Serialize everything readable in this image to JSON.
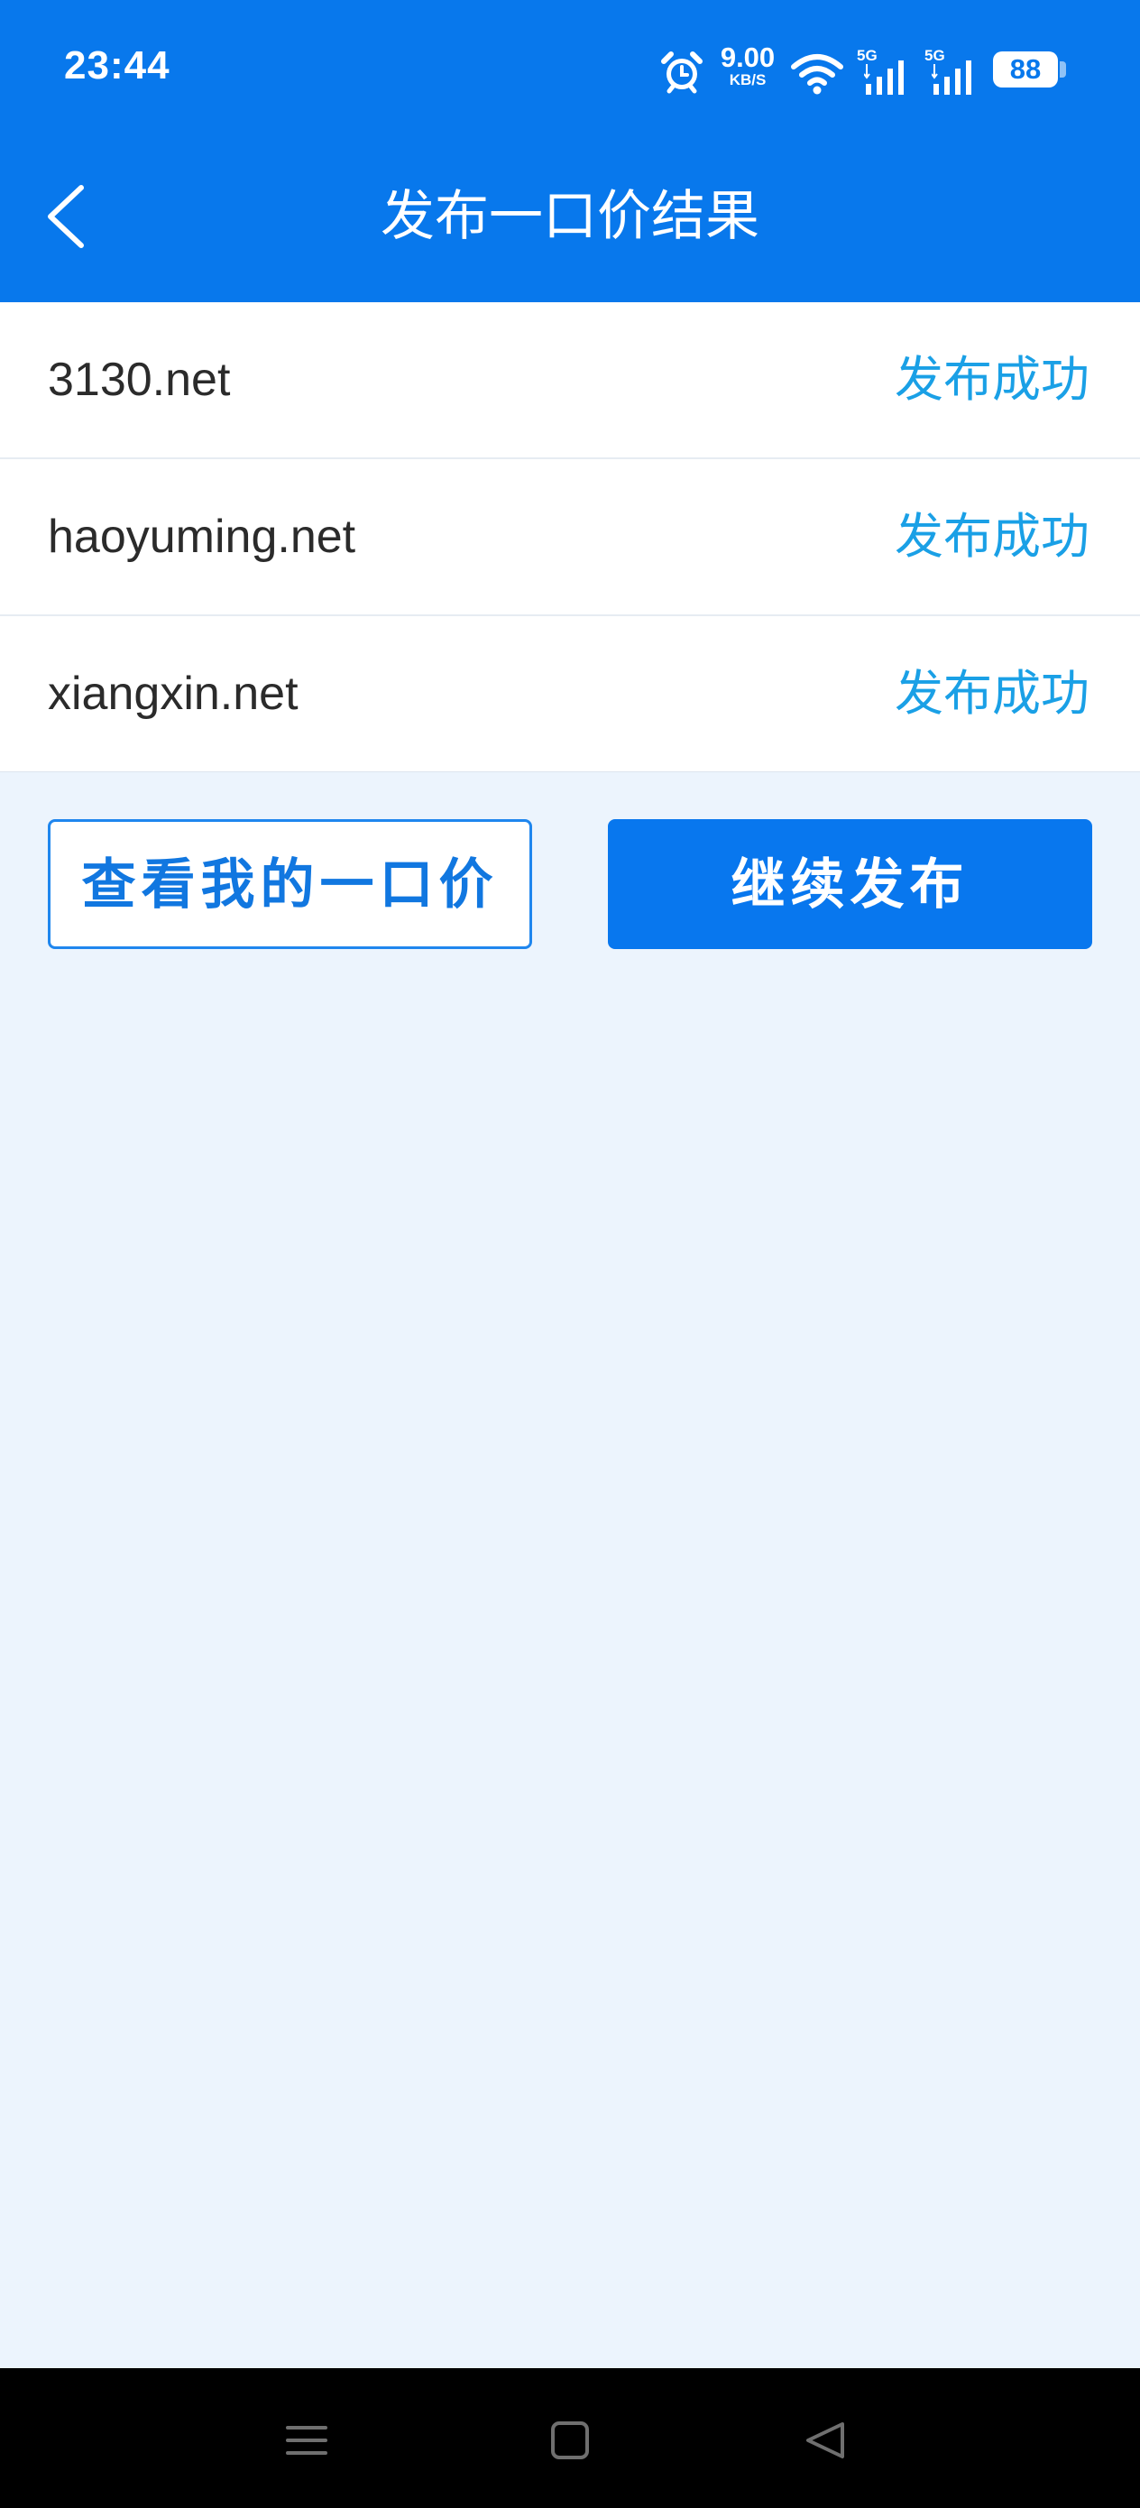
{
  "status_bar": {
    "time": "23:44",
    "net_speed_value": "9.00",
    "net_speed_unit": "KB/S",
    "signal_1_label": "5G",
    "signal_2_label": "5G",
    "battery_level": "88",
    "icons": [
      "alarm-icon",
      "wifi-icon",
      "signal-icon",
      "signal-icon",
      "battery-icon"
    ]
  },
  "header": {
    "title": "发布一口价结果",
    "back_icon": "chevron-left-icon"
  },
  "results": [
    {
      "domain": "3130.net",
      "status": "发布成功"
    },
    {
      "domain": "haoyuming.net",
      "status": "发布成功"
    },
    {
      "domain": "xiangxin.net",
      "status": "发布成功"
    }
  ],
  "actions": {
    "view_label": "查看我的一口价",
    "continue_label": "继续发布"
  },
  "nav_bar": {
    "icons": [
      "menu-icon",
      "home-icon",
      "back-triangle-icon"
    ]
  },
  "colors": {
    "primary": "#0878ec",
    "success_text": "#1aa0e6",
    "page_background": "#ecf4fd"
  }
}
